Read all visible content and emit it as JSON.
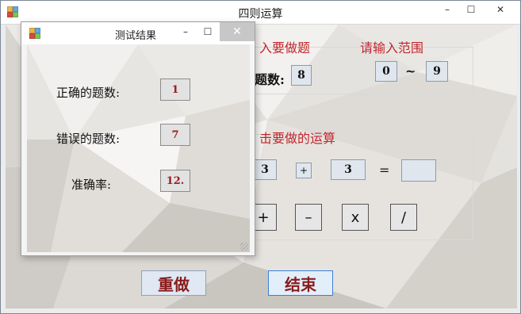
{
  "main_window": {
    "title": "四则运算",
    "controls": {
      "minimize": "–",
      "maximize": "☐",
      "close": "✕"
    }
  },
  "setup": {
    "question_heading": "入要做题",
    "question_count_label": "题数:",
    "question_count_value": "8",
    "range_heading": "请输入范围",
    "range_min": "0",
    "range_separator": "~",
    "range_max": "9"
  },
  "operation": {
    "heading": "击要做的运算",
    "operand1": "3",
    "operator": "+",
    "operand2": "3",
    "equals": "=",
    "answer": ""
  },
  "operator_buttons": [
    "+",
    "–",
    "x",
    "/"
  ],
  "bottom_buttons": {
    "redo": "重做",
    "end": "结束"
  },
  "dialog": {
    "title": "测试结果",
    "controls": {
      "minimize": "–",
      "maximize": "☐",
      "close": "✕"
    },
    "correct_label": "正确的题数:",
    "correct_value": "1",
    "wrong_label": "错误的题数:",
    "wrong_value": "7",
    "accuracy_label": "准确率:",
    "accuracy_value": "12."
  },
  "icons": {
    "app_icon": "app-icon",
    "dialog_icon": "app-icon"
  },
  "colors": {
    "heading_red": "#c1272d",
    "value_darkred": "#9b1c1c",
    "button_text": "#8a1c1c"
  }
}
